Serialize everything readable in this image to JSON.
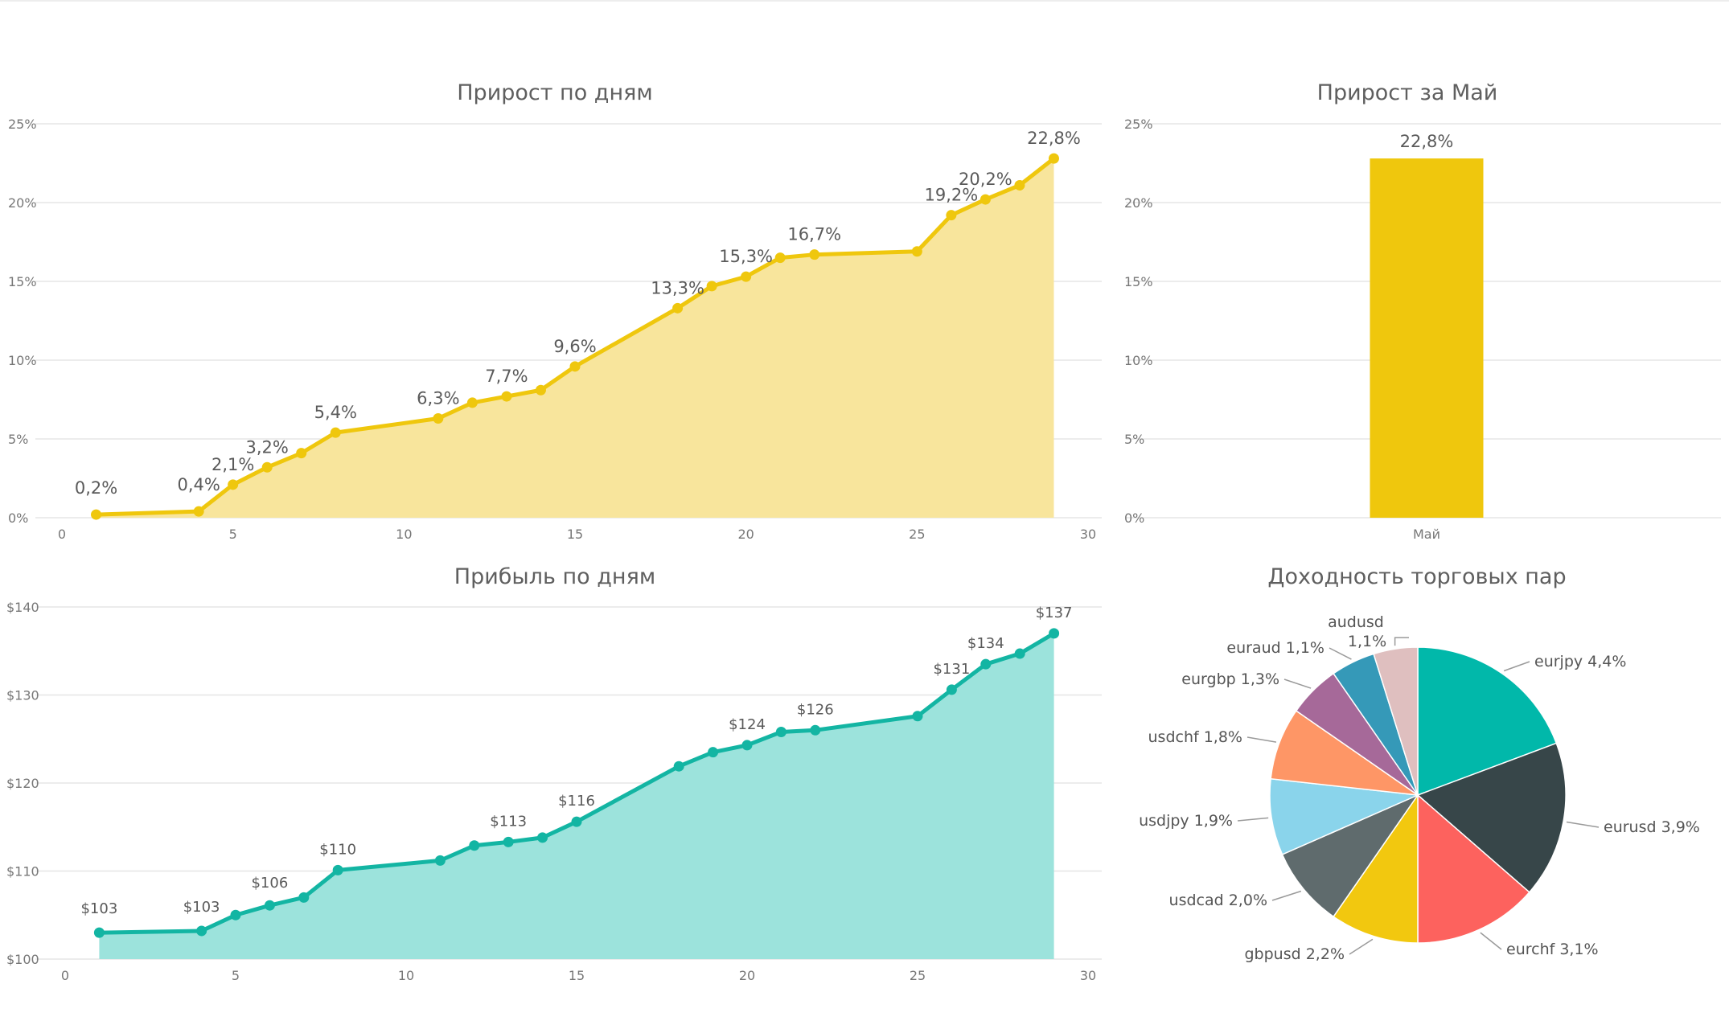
{
  "chart_data": [
    {
      "type": "area",
      "title": "Прирост по дням",
      "x": [
        1,
        4,
        5,
        6,
        7,
        8,
        11,
        12,
        13,
        14,
        15,
        18,
        19,
        20,
        21,
        22,
        25,
        26,
        27,
        28,
        29
      ],
      "values": [
        0.2,
        0.4,
        2.1,
        3.2,
        4.1,
        5.4,
        6.3,
        7.3,
        7.7,
        8.1,
        9.6,
        13.3,
        14.7,
        15.3,
        16.5,
        16.7,
        16.9,
        19.2,
        20.2,
        21.1,
        22.8
      ],
      "labels": {
        "1": "0,2%",
        "4": "0,4%",
        "5": "2,1%",
        "6": "3,2%",
        "8": "5,4%",
        "11": "6,3%",
        "13": "7,7%",
        "15": "9,6%",
        "18": "13,3%",
        "20": "15,3%",
        "22": "16,7%",
        "26": "19,2%",
        "27": "20,2%",
        "29": "22,8%"
      },
      "xticks": [
        0,
        5,
        10,
        15,
        20,
        25,
        30
      ],
      "xlim": [
        0,
        30
      ],
      "yticks": [
        "0%",
        "5%",
        "10%",
        "15%",
        "20%",
        "25%"
      ],
      "yvalues": [
        0,
        5,
        10,
        15,
        20,
        25
      ],
      "ylim": [
        0,
        25
      ],
      "color": "#EFC70D",
      "fill_color": "#F8E59C",
      "grid": true
    },
    {
      "type": "bar",
      "title": "Прирост за Май",
      "categories": [
        "Май"
      ],
      "values": [
        22.8
      ],
      "labels": [
        "22,8%"
      ],
      "yticks": [
        "0%",
        "5%",
        "10%",
        "15%",
        "20%",
        "25%"
      ],
      "yvalues": [
        0,
        5,
        10,
        15,
        20,
        25
      ],
      "ylim": [
        0,
        25
      ],
      "color": "#EFC70D",
      "grid": true
    },
    {
      "type": "area",
      "title": "Прибыль по дням",
      "x": [
        1,
        4,
        5,
        6,
        7,
        8,
        11,
        12,
        13,
        14,
        15,
        18,
        19,
        20,
        21,
        22,
        25,
        26,
        27,
        28,
        29
      ],
      "values": [
        103.0,
        103.2,
        105.0,
        106.1,
        107.0,
        110.1,
        111.2,
        112.9,
        113.3,
        113.8,
        115.6,
        121.9,
        123.5,
        124.3,
        125.8,
        126.0,
        127.6,
        130.6,
        133.5,
        134.7,
        137.0
      ],
      "labels": {
        "1": "$103",
        "4": "$103",
        "6": "$106",
        "8": "$110",
        "13": "$113",
        "15": "$116",
        "20": "$124",
        "22": "$126",
        "26": "$131",
        "27": "$134",
        "29": "$137"
      },
      "xticks": [
        0,
        5,
        10,
        15,
        20,
        25,
        30
      ],
      "xlim": [
        0,
        30
      ],
      "yticks": [
        "$100",
        "$110",
        "$120",
        "$130",
        "$140"
      ],
      "yvalues": [
        100,
        110,
        120,
        130,
        140
      ],
      "ylim": [
        100,
        140
      ],
      "color": "#13B5A3",
      "fill_color": "#9CE3DC",
      "grid": true
    },
    {
      "type": "pie",
      "title": "Доходность торговых пар",
      "slices": [
        {
          "name": "eurjpy",
          "value": 4.4,
          "label": "eurjpy 4,4%",
          "color": "#01B8AA"
        },
        {
          "name": "eurusd",
          "value": 3.9,
          "label": "eurusd 3,9%",
          "color": "#374649"
        },
        {
          "name": "eurchf",
          "value": 3.1,
          "label": "eurchf 3,1%",
          "color": "#FD625E"
        },
        {
          "name": "gbpusd",
          "value": 2.2,
          "label": "gbpusd 2,2%",
          "color": "#F2C80F"
        },
        {
          "name": "usdcad",
          "value": 2.0,
          "label": "usdcad 2,0%",
          "color": "#5F6B6D"
        },
        {
          "name": "usdjpy",
          "value": 1.9,
          "label": "usdjpy 1,9%",
          "color": "#8AD4EB"
        },
        {
          "name": "usdchf",
          "value": 1.8,
          "label": "usdchf 1,8%",
          "color": "#FE9666"
        },
        {
          "name": "eurgbp",
          "value": 1.3,
          "label": "eurgbp 1,3%",
          "color": "#A66999"
        },
        {
          "name": "euraud",
          "value": 1.1,
          "label": "euraud 1,1%",
          "color": "#3599B8"
        },
        {
          "name": "audusd",
          "value": 1.1,
          "label": "audusd 1,1%",
          "color": "#DFBFBF"
        }
      ]
    }
  ]
}
